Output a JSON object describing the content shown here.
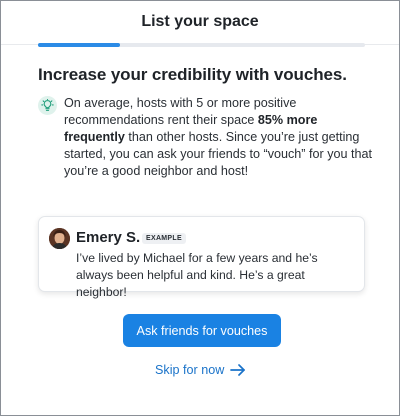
{
  "header": {
    "title": "List your space"
  },
  "progress": {
    "fraction": 0.25
  },
  "headline": "Increase your credibility with vouches.",
  "tip": {
    "icon": "lightbulb-icon",
    "text_before": "On average, hosts with 5 or more positive recommendations rent their space ",
    "highlight": "85% more frequently",
    "text_after": " than other hosts. Since you’re just getting started, you can ask your friends to “vouch” for you that you’re a good neighbor and host!"
  },
  "example_card": {
    "name": "Emery S.",
    "badge": "EXAMPLE",
    "quote": "I’ve lived by Michael for a few years and he’s always been helpful and kind. He’s a great neighbor!"
  },
  "actions": {
    "primary_label": "Ask friends for vouches",
    "skip_label": "Skip for now",
    "skip_icon": "arrow-right-icon"
  },
  "colors": {
    "accent": "#1a82e3",
    "link": "#1a73c9",
    "tip_icon_bg": "#dff2ec",
    "tip_icon_fg": "#1f9d7a"
  }
}
